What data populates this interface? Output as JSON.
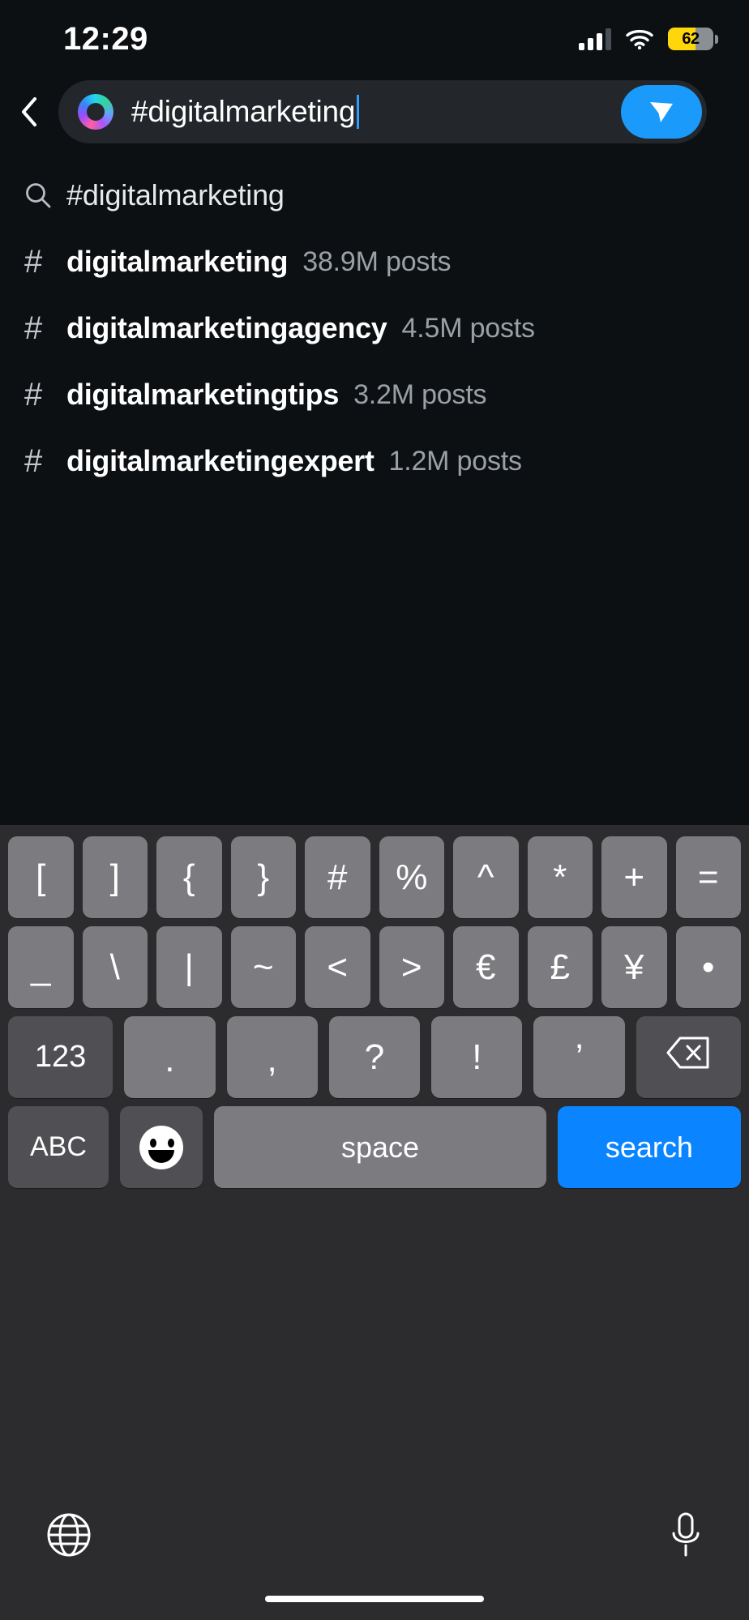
{
  "status_bar": {
    "time": "12:29",
    "battery_percent": "62",
    "signal_icon": "cellular-signal-icon",
    "wifi_icon": "wifi-icon",
    "battery_icon": "battery-low-power-icon",
    "battery_fill_color": "#ffd60a"
  },
  "header": {
    "back_icon": "back-chevron-icon",
    "logo_icon": "gradient-ring-logo-icon",
    "query": "#digitalmarketing",
    "send_icon": "send-paper-plane-icon",
    "send_color": "#1a9bfc"
  },
  "suggestions": {
    "query_row": {
      "icon": "search-icon",
      "label": "#digitalmarketing"
    },
    "hashtags": [
      {
        "icon": "hashtag-icon",
        "tag": "digitalmarketing",
        "count": "38.9M posts"
      },
      {
        "icon": "hashtag-icon",
        "tag": "digitalmarketingagency",
        "count": "4.5M posts"
      },
      {
        "icon": "hashtag-icon",
        "tag": "digitalmarketingtips",
        "count": "3.2M posts"
      },
      {
        "icon": "hashtag-icon",
        "tag": "digitalmarketingexpert",
        "count": "1.2M posts"
      }
    ]
  },
  "keyboard": {
    "row1": [
      "[",
      "]",
      "{",
      "}",
      "#",
      "%",
      "^",
      "*",
      "+",
      "="
    ],
    "row2": [
      "_",
      "\\",
      "|",
      "~",
      "<",
      ">",
      "€",
      "£",
      "¥",
      "•"
    ],
    "row3": {
      "numeric_key": "123",
      "keys": [
        ".",
        ",",
        "?",
        "!",
        "’"
      ],
      "backspace_icon": "backspace-delete-icon"
    },
    "row4": {
      "abc_key": "ABC",
      "emoji_icon": "emoji-smiley-icon",
      "space_key": "space",
      "search_key": "search",
      "search_color": "#0a84ff"
    },
    "bottom": {
      "globe_icon": "globe-language-icon",
      "mic_icon": "microphone-dictation-icon"
    }
  }
}
